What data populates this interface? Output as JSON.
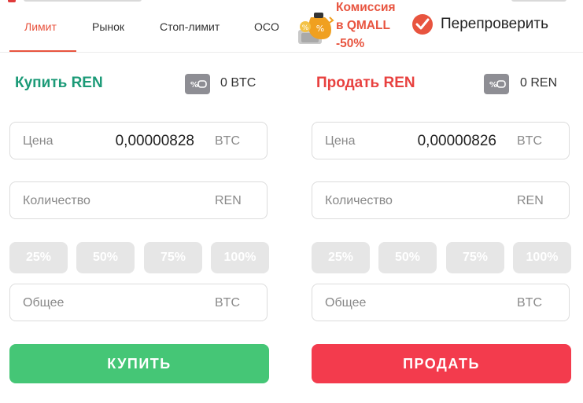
{
  "tabs": [
    {
      "label": "Лимит",
      "active": true
    },
    {
      "label": "Рынок"
    },
    {
      "label": "Стоп-лимит"
    },
    {
      "label": "OCO"
    }
  ],
  "promo": {
    "line1": "Комиссия",
    "line2": "в QMALL",
    "line3": "-50%"
  },
  "recheck": {
    "label": "Перепроверить",
    "checked": true
  },
  "buy": {
    "title": "Купить REN",
    "balance": "0 BTC",
    "price_label": "Цена",
    "price_value": "0,00000828",
    "price_unit": "BTC",
    "amount_label": "Количество",
    "amount_unit": "REN",
    "percents": [
      "25%",
      "50%",
      "75%",
      "100%"
    ],
    "total_label": "Общее",
    "total_unit": "BTC",
    "button": "КУПИТЬ"
  },
  "sell": {
    "title": "Продать REN",
    "balance": "0 REN",
    "price_label": "Цена",
    "price_value": "0,00000826",
    "price_unit": "BTC",
    "amount_label": "Количество",
    "amount_unit": "REN",
    "percents": [
      "25%",
      "50%",
      "75%",
      "100%"
    ],
    "total_label": "Общее",
    "total_unit": "BTC",
    "button": "ПРОДАТЬ"
  },
  "colors": {
    "accent": "#e8543f",
    "buy_green": "#1b9a77",
    "buy_button": "#45c676",
    "sell_red": "#e8413f",
    "sell_button": "#f33b4d"
  }
}
